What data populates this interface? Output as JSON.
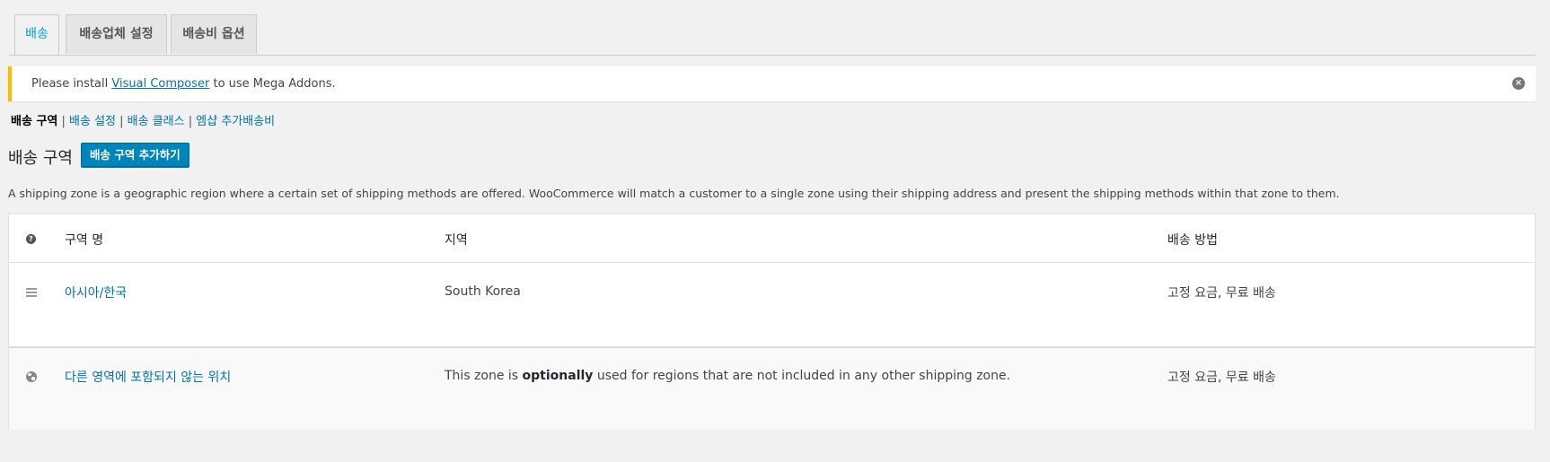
{
  "tabs": [
    {
      "label": "배송"
    },
    {
      "label": "배송업체 설정"
    },
    {
      "label": "배송비 옵션"
    }
  ],
  "notice": {
    "prefix": "Please install ",
    "link": "Visual Composer",
    "suffix": " to use Mega Addons."
  },
  "subnav": {
    "current": "배송 구역",
    "sep": " | ",
    "links": [
      "배송 설정",
      "배송 클래스",
      "엠샵 추가배송비"
    ]
  },
  "heading": "배송 구역",
  "add_button": "배송 구역 추가하기",
  "description": "A shipping zone is a geographic region where a certain set of shipping methods are offered. WooCommerce will match a customer to a single zone using their shipping address and present the shipping methods within that zone to them.",
  "table": {
    "headers": {
      "name": "구역 명",
      "region": "지역",
      "methods": "배송 방법"
    },
    "rows": [
      {
        "name": "아시아/한국",
        "region": "South Korea",
        "methods": "고정 요금, 무료 배송"
      }
    ],
    "rest": {
      "name": "다른 영역에 포함되지 않는 위치",
      "region_pre": "This zone is ",
      "region_bold": "optionally",
      "region_post": " used for regions that are not included in any other shipping zone.",
      "methods": "고정 요금, 무료 배송"
    }
  },
  "colors": {
    "accent": "#00a0d2",
    "link": "#0073aa",
    "button": "#0085ba",
    "notice_border": "#ffb900"
  }
}
